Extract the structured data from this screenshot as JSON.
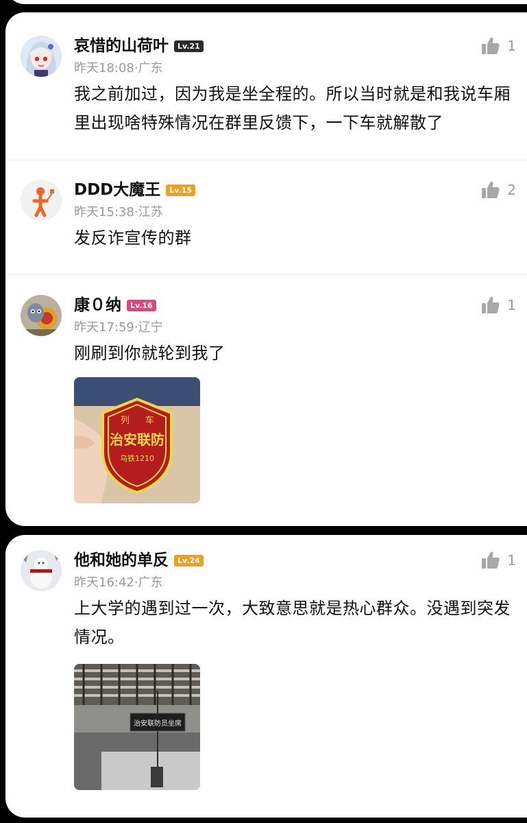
{
  "comments": [
    {
      "name": "哀惜的山荷叶",
      "level": "Lv.21",
      "level_color": "#2b2b2b",
      "time": "昨天18:08",
      "location": "广东",
      "meta": "昨天18:08·广东",
      "text": "我之前加过，因为我是坐全程的。所以当时就是和我说车厢里出现啥特殊情况在群里反馈下，一下车就解散了",
      "likes": "1",
      "avatar_icon": "anime-girl-avatar-icon"
    },
    {
      "name": "DDD大魔王",
      "level": "Lv.15",
      "level_color": "#f0a020",
      "time": "昨天15:38",
      "location": "江苏",
      "meta": "昨天15:38·江苏",
      "text": "发反诈宣传的群",
      "likes": "2",
      "avatar_icon": "stick-figure-avatar-icon"
    },
    {
      "name": "康０纳",
      "level": "Lv.16",
      "level_color": "#e0457b",
      "time": "昨天17:59",
      "location": "辽宁",
      "meta": "昨天17:59·辽宁",
      "text": "刚刷到你就轮到我了",
      "likes": "1",
      "avatar_icon": "cartoon-cat-avatar-icon",
      "photo": {
        "badge_top": "列",
        "badge_top2": "车",
        "badge_main": "治安联防",
        "badge_sub": "乌铁1210"
      }
    },
    {
      "name": "他和她的单反",
      "level": "Lv.24",
      "level_color": "#f0a020",
      "time": "昨天16:42",
      "location": "广东",
      "meta": "昨天16:42·广东",
      "text": "上大学的遇到过一次，大致意思就是热心群众。没遇到突发情况。",
      "likes": "1",
      "avatar_icon": "snowman-avatar-icon",
      "photo": {
        "sign": "治安联防员坐席"
      }
    }
  ],
  "colors": {
    "name": "#111111",
    "meta": "#9a9a9a",
    "background": "#000000",
    "card": "#ffffff"
  }
}
